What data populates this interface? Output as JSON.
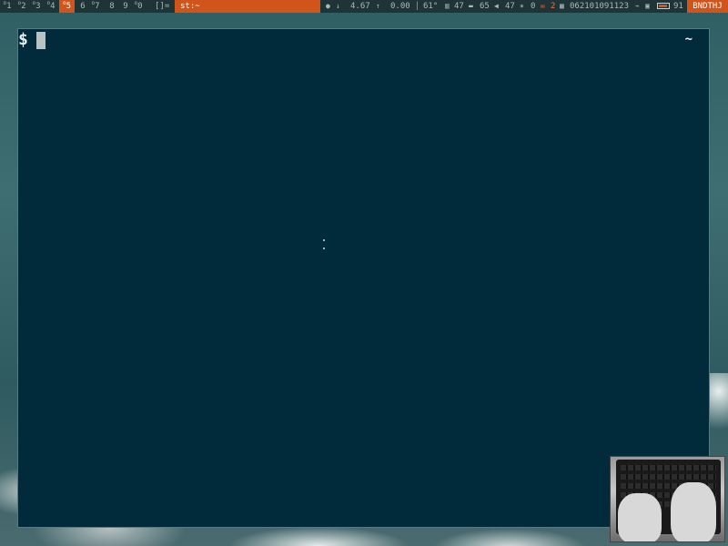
{
  "statusbar": {
    "workspaces": [
      {
        "label": "1",
        "marker": "o",
        "active": false
      },
      {
        "label": "2",
        "marker": "o",
        "active": false
      },
      {
        "label": "3",
        "marker": "o",
        "active": false
      },
      {
        "label": "4",
        "marker": "o",
        "active": false
      },
      {
        "label": "5",
        "marker": "o",
        "active": true
      },
      {
        "label": "6",
        "marker": "",
        "active": false
      },
      {
        "label": "7",
        "marker": "o",
        "active": false
      },
      {
        "label": "8",
        "marker": "",
        "active": false
      },
      {
        "label": "9",
        "marker": "",
        "active": false
      },
      {
        "label": "0",
        "marker": "o",
        "active": false
      }
    ],
    "layout_symbol": "[]=",
    "window_title": "st:~",
    "net_down": "4.67",
    "net_up": "0.00",
    "temperature": "61°",
    "memory": "47",
    "disk": "65",
    "volume": "47",
    "mic": "0",
    "mail_count": "2",
    "datetime": "062101091123",
    "battery": "91",
    "battery_level": 0.9,
    "tag": "BNDTHJ",
    "accent_color": "#d1541a"
  },
  "terminal": {
    "prompt": "$",
    "cwd": "~",
    "background_color": "#012b3a"
  }
}
